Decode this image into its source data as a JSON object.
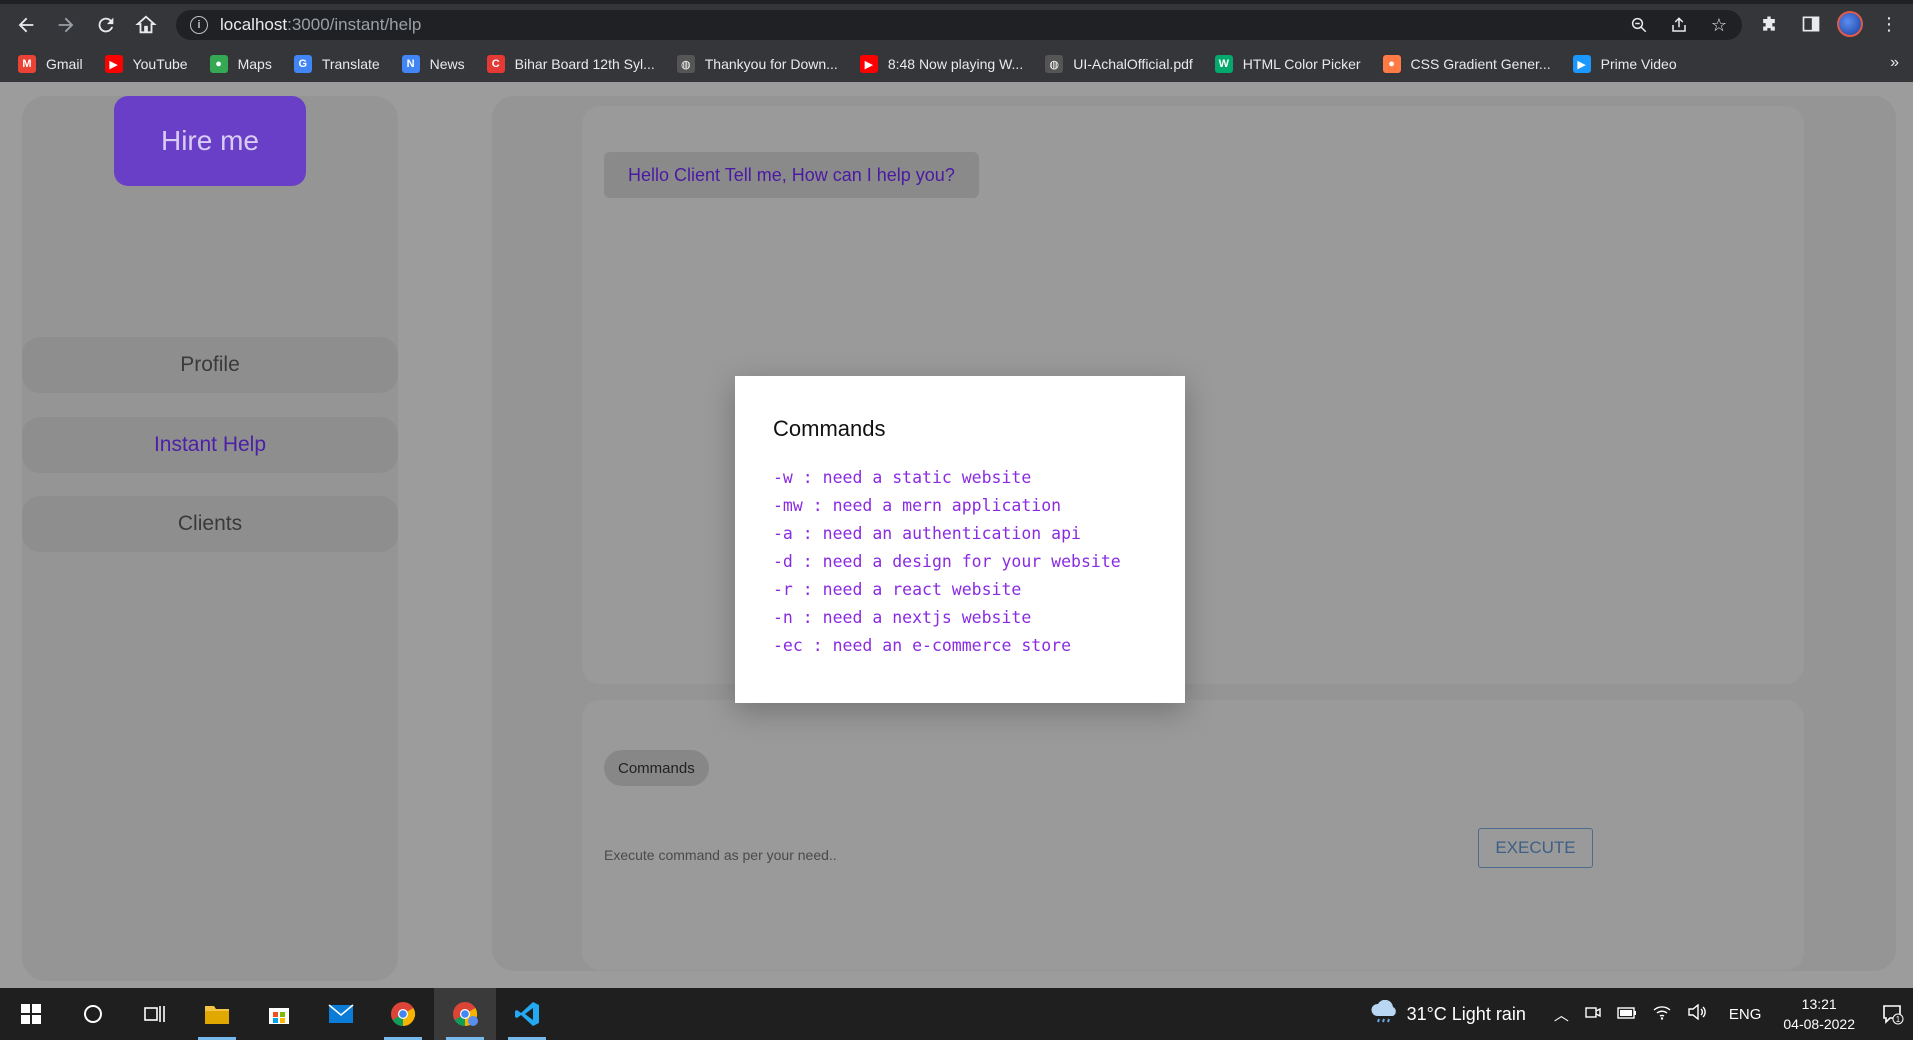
{
  "browser": {
    "url_host": "localhost",
    "url_path": ":3000/instant/help",
    "bookmarks": [
      {
        "label": "Gmail",
        "icon": "gmail-icon",
        "color": "#ea4335",
        "glyph": "M"
      },
      {
        "label": "YouTube",
        "icon": "youtube-icon",
        "color": "#ff0000",
        "glyph": "▶"
      },
      {
        "label": "Maps",
        "icon": "maps-icon",
        "color": "#34a853",
        "glyph": "●"
      },
      {
        "label": "Translate",
        "icon": "translate-icon",
        "color": "#4285f4",
        "glyph": "G"
      },
      {
        "label": "News",
        "icon": "news-icon",
        "color": "#4285f4",
        "glyph": "N"
      },
      {
        "label": "Bihar Board 12th Syl...",
        "icon": "bihar-board-icon",
        "color": "#e53935",
        "glyph": "C"
      },
      {
        "label": "Thankyou for Down...",
        "icon": "globe-icon",
        "color": "#555555",
        "glyph": "◍"
      },
      {
        "label": "8:48 Now playing W...",
        "icon": "youtube-icon",
        "color": "#ff0000",
        "glyph": "▶"
      },
      {
        "label": "UI-AchalOfficial.pdf",
        "icon": "globe-icon",
        "color": "#555555",
        "glyph": "◍"
      },
      {
        "label": "HTML Color Picker",
        "icon": "w3schools-icon",
        "color": "#04aa6d",
        "glyph": "W"
      },
      {
        "label": "CSS Gradient Gener...",
        "icon": "gradient-icon",
        "color": "#ff7a45",
        "glyph": "●"
      },
      {
        "label": "Prime Video",
        "icon": "prime-video-icon",
        "color": "#1a98ff",
        "glyph": "▶"
      }
    ],
    "more_glyph": "»"
  },
  "sidebar": {
    "hire_label": "Hire me",
    "items": [
      {
        "label": "Profile",
        "active": false
      },
      {
        "label": "Instant Help",
        "active": true
      },
      {
        "label": "Clients",
        "active": false
      }
    ]
  },
  "chat": {
    "greeting": "Hello Client Tell me, How can I help you?"
  },
  "command_bar": {
    "chip_label": "Commands",
    "input_placeholder": "Execute command as per your need..",
    "execute_label": "EXECUTE"
  },
  "modal": {
    "title": "Commands",
    "commands": [
      "-w : need a static website",
      "-mw : need a mern application",
      "-a : need an authentication api",
      "-d : need a design for your website",
      "-r : need a react website",
      "-n : need a nextjs website",
      "-ec : need an e-commerce store"
    ]
  },
  "taskbar": {
    "weather": "31°C  Light rain",
    "language": "ENG",
    "time": "13:21",
    "date": "04-08-2022",
    "notification_count": "1"
  },
  "colors": {
    "accent_purple": "#6a3fc8",
    "command_text": "#8a2be2"
  }
}
